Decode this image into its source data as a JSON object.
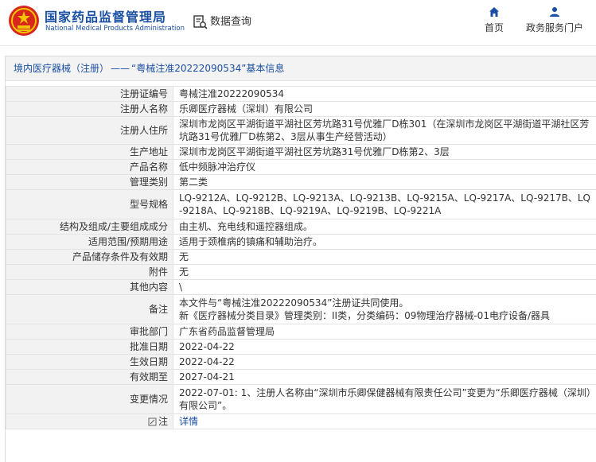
{
  "header": {
    "brand_cn": "国家药品监督管理局",
    "brand_en": "National Medical Products Administration",
    "query_title": "数据查询",
    "nav": [
      {
        "label": "首页",
        "icon": "home-icon"
      },
      {
        "label": "政务服务门户",
        "icon": "user-icon"
      }
    ]
  },
  "colors": {
    "brand": "#1a4fa3",
    "label_bg": "#f2f2f2",
    "border": "#e3e3e3",
    "emblem_red": "#d9261c",
    "emblem_gold": "#f4c400"
  },
  "panel": {
    "title_category": "境内医疗器械（注册）",
    "title_sep": "——",
    "title_main": "“粤械注准20222090534”基本信息"
  },
  "rows": [
    {
      "label": "注册证编号",
      "value": "粤械注准20222090534"
    },
    {
      "label": "注册人名称",
      "value": "乐卿医疗器械（深圳）有限公司"
    },
    {
      "label": "注册人住所",
      "value": "深圳市龙岗区平湖街道平湖社区芳坑路31号优雅厂D栋301（在深圳市龙岗区平湖街道平湖社区芳坑路31号优雅厂D栋第2、3层从事生产经营活动）"
    },
    {
      "label": "生产地址",
      "value": "深圳市龙岗区平湖街道平湖社区芳坑路31号优雅厂D栋第2、3层"
    },
    {
      "label": "产品名称",
      "value": "低中频脉冲治疗仪"
    },
    {
      "label": "管理类别",
      "value": "第二类"
    },
    {
      "label": "型号规格",
      "value": "LQ-9212A、LQ-9212B、LQ-9213A、LQ-9213B、LQ-9215A、LQ-9217A、LQ-9217B、LQ-9218A、LQ-9218B、LQ-9219A、LQ-9219B、LQ-9221A"
    },
    {
      "label": "结构及组成/主要组成成分",
      "value": "由主机、充电线和遥控器组成。"
    },
    {
      "label": "适用范围/预期用途",
      "value": "适用于颈椎病的镇痛和辅助治疗。"
    },
    {
      "label": "产品储存条件及有效期",
      "value": "无"
    },
    {
      "label": "附件",
      "value": "无"
    },
    {
      "label": "其他内容",
      "value": "\\"
    },
    {
      "label": "备注",
      "value_lines": [
        "本文件与“粤械注准20222090534”注册证共同使用。",
        "新《医疗器械分类目录》管理类别：II类，分类编码：09物理治疗器械-01电疗设备/器具"
      ]
    },
    {
      "label": "审批部门",
      "value": "广东省药品监督管理局"
    },
    {
      "label": "批准日期",
      "value": "2022-04-22"
    },
    {
      "label": "生效日期",
      "value": "2022-04-22"
    },
    {
      "label": "有效期至",
      "value": "2027-04-21"
    },
    {
      "label": "变更情况",
      "value": "2022-07-01: 1、注册人名称由“深圳市乐卿保健器械有限责任公司”变更为“乐卿医疗器械（深圳）有限公司”。"
    },
    {
      "label": "注",
      "icon": "note-icon",
      "value": "详情"
    }
  ]
}
